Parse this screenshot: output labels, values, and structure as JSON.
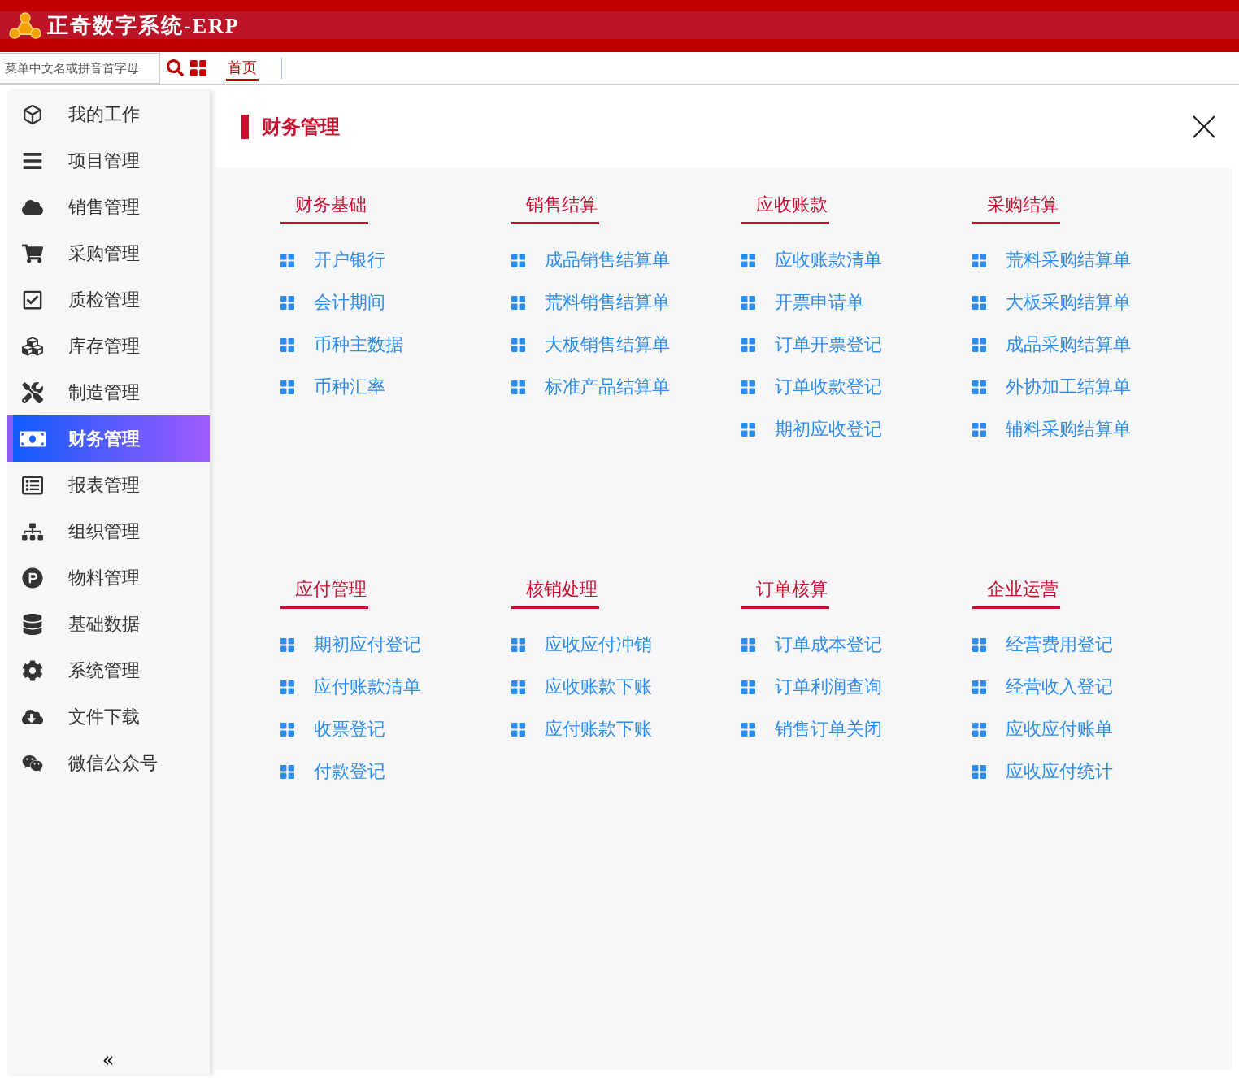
{
  "app": {
    "title": "正奇数字系统-ERP"
  },
  "search": {
    "placeholder": "菜单中文名或拼音首字母"
  },
  "tabs": [
    {
      "label": "首页",
      "selected": true
    }
  ],
  "sidebar": {
    "items": [
      {
        "label": "我的工作",
        "selected": false
      },
      {
        "label": "项目管理",
        "selected": false
      },
      {
        "label": "销售管理",
        "selected": false
      },
      {
        "label": "采购管理",
        "selected": false
      },
      {
        "label": "质检管理",
        "selected": false
      },
      {
        "label": "库存管理",
        "selected": false
      },
      {
        "label": "制造管理",
        "selected": false
      },
      {
        "label": "财务管理",
        "selected": true
      },
      {
        "label": "报表管理",
        "selected": false
      },
      {
        "label": "组织管理",
        "selected": false
      },
      {
        "label": "物料管理",
        "selected": false
      },
      {
        "label": "基础数据",
        "selected": false
      },
      {
        "label": "系统管理",
        "selected": false
      },
      {
        "label": "文件下载",
        "selected": false
      },
      {
        "label": "微信公众号",
        "selected": false
      }
    ],
    "collapse": "«"
  },
  "panel": {
    "title": "财务管理",
    "sections": [
      {
        "heading": "财务基础",
        "links": [
          "开户银行",
          "会计期间",
          "币种主数据",
          "币种汇率"
        ]
      },
      {
        "heading": "销售结算",
        "links": [
          "成品销售结算单",
          "荒料销售结算单",
          "大板销售结算单",
          "标准产品结算单"
        ]
      },
      {
        "heading": "应收账款",
        "links": [
          "应收账款清单",
          "开票申请单",
          "订单开票登记",
          "订单收款登记",
          "期初应收登记"
        ]
      },
      {
        "heading": "采购结算",
        "links": [
          "荒料采购结算单",
          "大板采购结算单",
          "成品采购结算单",
          "外协加工结算单",
          "辅料采购结算单"
        ]
      },
      {
        "heading": "应付管理",
        "links": [
          "期初应付登记",
          "应付账款清单",
          "收票登记",
          "付款登记"
        ]
      },
      {
        "heading": "核销处理",
        "links": [
          "应收应付冲销",
          "应收账款下账",
          "应付账款下账"
        ]
      },
      {
        "heading": "订单核算",
        "links": [
          "订单成本登记",
          "订单利润查询",
          "销售订单关闭"
        ]
      },
      {
        "heading": "企业运营",
        "links": [
          "经营费用登记",
          "经营收入登记",
          "应收应付账单",
          "应收应付统计"
        ]
      }
    ]
  }
}
